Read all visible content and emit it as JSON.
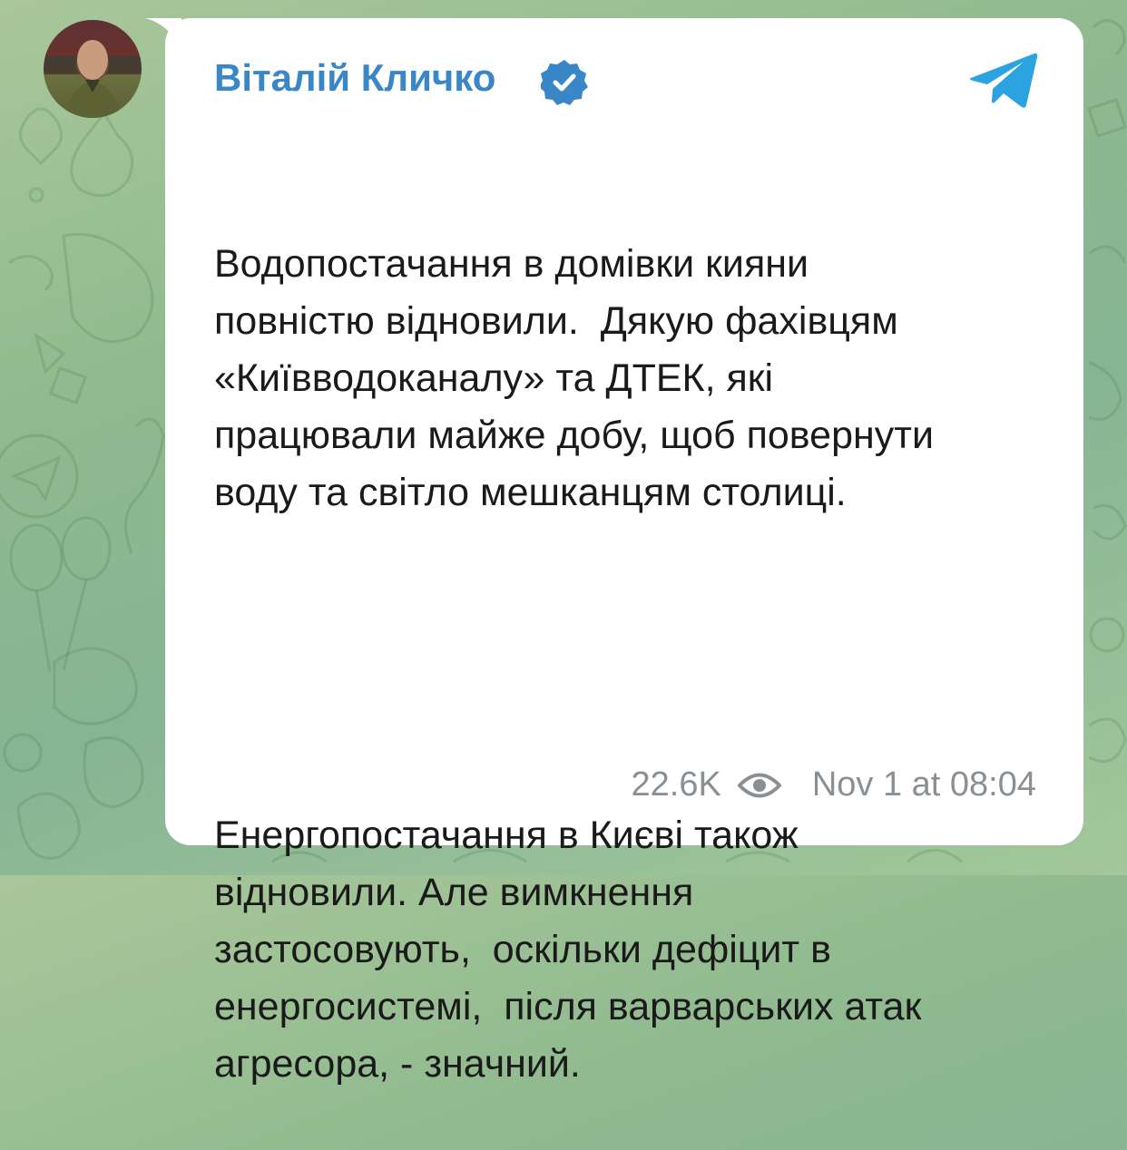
{
  "post": {
    "channel_name": "Віталій Кличко",
    "verified": true,
    "paragraphs": [
      "Водопостачання в домівки кияни\nповністю відновили.  Дякую фахівцям\n«Київводоканалу» та ДТЕК, які\nпрацювали майже добу, щоб повернути\nводу та світло мешканцям столиці.",
      "Енергопостачання в Києві також\nвідновили. Але вимкнення\nзастосовують,  оскільки дефіцит в\nенергосистемі,  після варварських атак\nагресора, - значний."
    ],
    "views": "22.6K",
    "timestamp": "Nov 1 at 08:04"
  },
  "colors": {
    "accent": "#3a87c8",
    "telegram_blue": "#2aa3e0",
    "meta_gray": "#8a8f94",
    "bubble": "#ffffff"
  },
  "icons": {
    "verified": "verified-badge-icon",
    "telegram": "telegram-logo-icon",
    "views": "eye-icon"
  }
}
